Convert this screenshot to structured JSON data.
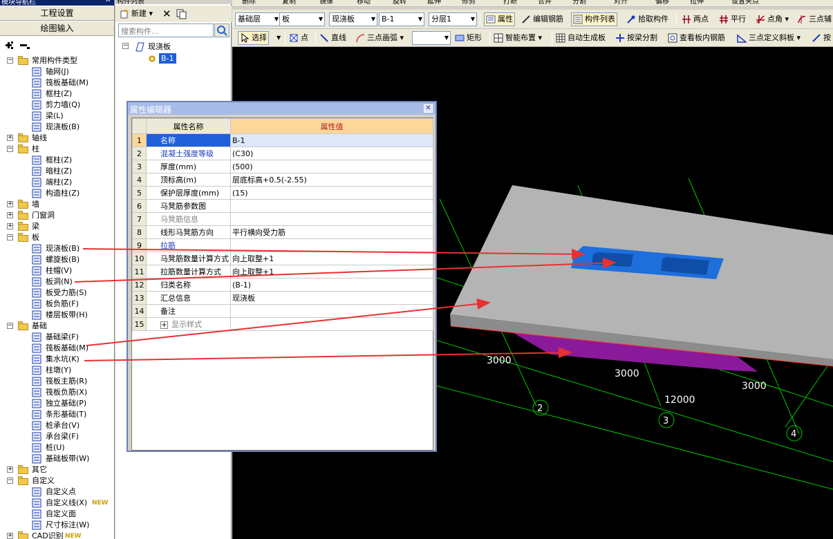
{
  "left_panel": {
    "caption": "模块导航栏",
    "nav_buttons": [
      "工程设置",
      "绘图输入"
    ],
    "tree": [
      {
        "label": "常用构件类型",
        "level": 0,
        "kind": "folder",
        "expanded": true
      },
      {
        "label": "轴网(J)",
        "level": 1,
        "icon": "grid-icon"
      },
      {
        "label": "筏板基础(M)",
        "level": 1,
        "icon": "raft-foundation-icon"
      },
      {
        "label": "框柱(Z)",
        "level": 1,
        "icon": "column-icon"
      },
      {
        "label": "剪力墙(Q)",
        "level": 1,
        "icon": "shear-wall-icon"
      },
      {
        "label": "梁(L)",
        "level": 1,
        "icon": "beam-icon"
      },
      {
        "label": "现浇板(B)",
        "level": 1,
        "icon": "slab-icon"
      },
      {
        "label": "轴线",
        "level": 0,
        "kind": "folder",
        "expanded": false
      },
      {
        "label": "柱",
        "level": 0,
        "kind": "folder",
        "expanded": true
      },
      {
        "label": "框柱(Z)",
        "level": 1,
        "icon": "column-icon"
      },
      {
        "label": "暗柱(Z)",
        "level": 1,
        "icon": "column-icon"
      },
      {
        "label": "端柱(Z)",
        "level": 1,
        "icon": "column-icon"
      },
      {
        "label": "构造柱(Z)",
        "level": 1,
        "icon": "column-icon"
      },
      {
        "label": "墙",
        "level": 0,
        "kind": "folder",
        "expanded": false
      },
      {
        "label": "门窗洞",
        "level": 0,
        "kind": "folder",
        "expanded": false
      },
      {
        "label": "梁",
        "level": 0,
        "kind": "folder",
        "expanded": false
      },
      {
        "label": "板",
        "level": 0,
        "kind": "folder",
        "expanded": true
      },
      {
        "label": "现浇板(B)",
        "level": 1,
        "icon": "slab-icon"
      },
      {
        "label": "螺旋板(B)",
        "level": 1,
        "icon": "spiral-slab-icon"
      },
      {
        "label": "柱帽(V)",
        "level": 1,
        "icon": "column-cap-icon"
      },
      {
        "label": "板洞(N)",
        "level": 1,
        "icon": "slab-hole-icon"
      },
      {
        "label": "板受力筋(S)",
        "level": 1,
        "icon": "slab-rebar-icon"
      },
      {
        "label": "板负筋(F)",
        "level": 1,
        "icon": "slab-rebar-icon"
      },
      {
        "label": "楼层板带(H)",
        "level": 1,
        "icon": "slab-band-icon"
      },
      {
        "label": "基础",
        "level": 0,
        "kind": "folder",
        "expanded": true
      },
      {
        "label": "基础梁(F)",
        "level": 1,
        "icon": "foundation-beam-icon"
      },
      {
        "label": "筏板基础(M)",
        "level": 1,
        "icon": "raft-foundation-icon"
      },
      {
        "label": "集水坑(K)",
        "level": 1,
        "icon": "sump-pit-icon"
      },
      {
        "label": "柱墩(Y)",
        "level": 1,
        "icon": "column-pier-icon"
      },
      {
        "label": "筏板主筋(R)",
        "level": 1,
        "icon": "raft-rebar-icon"
      },
      {
        "label": "筏板负筋(X)",
        "level": 1,
        "icon": "raft-rebar-icon"
      },
      {
        "label": "独立基础(P)",
        "level": 1,
        "icon": "isolated-footing-icon"
      },
      {
        "label": "条形基础(T)",
        "level": 1,
        "icon": "strip-footing-icon"
      },
      {
        "label": "桩承台(V)",
        "level": 1,
        "icon": "pile-cap-icon"
      },
      {
        "label": "承台梁(F)",
        "level": 1,
        "icon": "cap-beam-icon"
      },
      {
        "label": "桩(U)",
        "level": 1,
        "icon": "pile-icon"
      },
      {
        "label": "基础板带(W)",
        "level": 1,
        "icon": "foundation-band-icon"
      },
      {
        "label": "其它",
        "level": 0,
        "kind": "folder",
        "expanded": false
      },
      {
        "label": "自定义",
        "level": 0,
        "kind": "folder",
        "expanded": true
      },
      {
        "label": "自定义点",
        "level": 1,
        "icon": "custom-point-icon"
      },
      {
        "label": "自定义线(X)",
        "level": 1,
        "icon": "custom-line-icon",
        "badge": "NEW"
      },
      {
        "label": "自定义面",
        "level": 1,
        "icon": "custom-face-icon"
      },
      {
        "label": "尺寸标注(W)",
        "level": 1,
        "icon": "dimension-icon"
      },
      {
        "label": "CAD识别",
        "level": 0,
        "kind": "folder",
        "expanded": false,
        "badge": "NEW"
      }
    ]
  },
  "component_list": {
    "caption": "构件列表",
    "new_label": "新建",
    "search_placeholder": "搜索构件...",
    "tree_root": "现浇板",
    "tree_child": "B-1"
  },
  "toolbar_top": {
    "items": [
      "删除",
      "复制",
      "镜像",
      "移动",
      "旋转",
      "延伸",
      "修剪",
      "打断",
      "合并",
      "分割",
      "对齐",
      "偏移",
      "拉伸",
      "设置夹点"
    ]
  },
  "toolbar_1": {
    "layer_combo": "基础层",
    "type_combo": "板",
    "sub_combo": "现浇板",
    "item_combo": "B-1",
    "floor_combo": "分层1",
    "buttons": [
      "属性",
      "编辑钢筋",
      "构件列表",
      "拾取构件",
      "两点",
      "平行",
      "点角",
      "三点辅"
    ]
  },
  "toolbar_2": {
    "buttons": [
      "选择",
      "点",
      "直线",
      "三点画弧",
      "矩形",
      "智能布置",
      "自动生成板",
      "按梁分割",
      "查看板内钢筋",
      "三点定义斜板",
      "按"
    ]
  },
  "viewport": {
    "colors": {
      "background": "#000000",
      "slab": "#b4b4b4",
      "sump": "#1e6edc",
      "foundation": "#8a1a9a",
      "grid": "#00c800",
      "arrow": "#e83030"
    },
    "dims": [
      "3000",
      "3000",
      "3000",
      "12000"
    ],
    "axis_labels": [
      "2",
      "3",
      "4"
    ]
  },
  "property_editor": {
    "title": "属性编辑器",
    "col_name": "属性名称",
    "col_value": "属性值",
    "rows": [
      {
        "no": "1",
        "name": "名称",
        "value": "B-1",
        "style": "selected"
      },
      {
        "no": "2",
        "name": "混凝土强度等级",
        "value": "(C30)",
        "style": "blue"
      },
      {
        "no": "3",
        "name": "厚度(mm)",
        "value": "(500)",
        "style": ""
      },
      {
        "no": "4",
        "name": "顶标高(m)",
        "value": "层底标高+0.5(-2.55)",
        "style": ""
      },
      {
        "no": "5",
        "name": "保护层厚度(mm)",
        "value": "(15)",
        "style": ""
      },
      {
        "no": "6",
        "name": "马凳筋参数图",
        "value": "",
        "style": ""
      },
      {
        "no": "7",
        "name": "马凳筋信息",
        "value": "",
        "style": "gray"
      },
      {
        "no": "8",
        "name": "线形马凳筋方向",
        "value": "平行横向受力筋",
        "style": ""
      },
      {
        "no": "9",
        "name": "拉筋",
        "value": "",
        "style": "blue"
      },
      {
        "no": "10",
        "name": "马凳筋数量计算方式",
        "value": "向上取整+1",
        "style": ""
      },
      {
        "no": "11",
        "name": "拉筋数量计算方式",
        "value": "向上取整+1",
        "style": ""
      },
      {
        "no": "12",
        "name": "归类名称",
        "value": "(B-1)",
        "style": ""
      },
      {
        "no": "13",
        "name": "汇总信息",
        "value": "现浇板",
        "style": ""
      },
      {
        "no": "14",
        "name": "备注",
        "value": "",
        "style": ""
      },
      {
        "no": "15",
        "name": "显示样式",
        "value": "",
        "style": "gray-expand"
      }
    ]
  }
}
